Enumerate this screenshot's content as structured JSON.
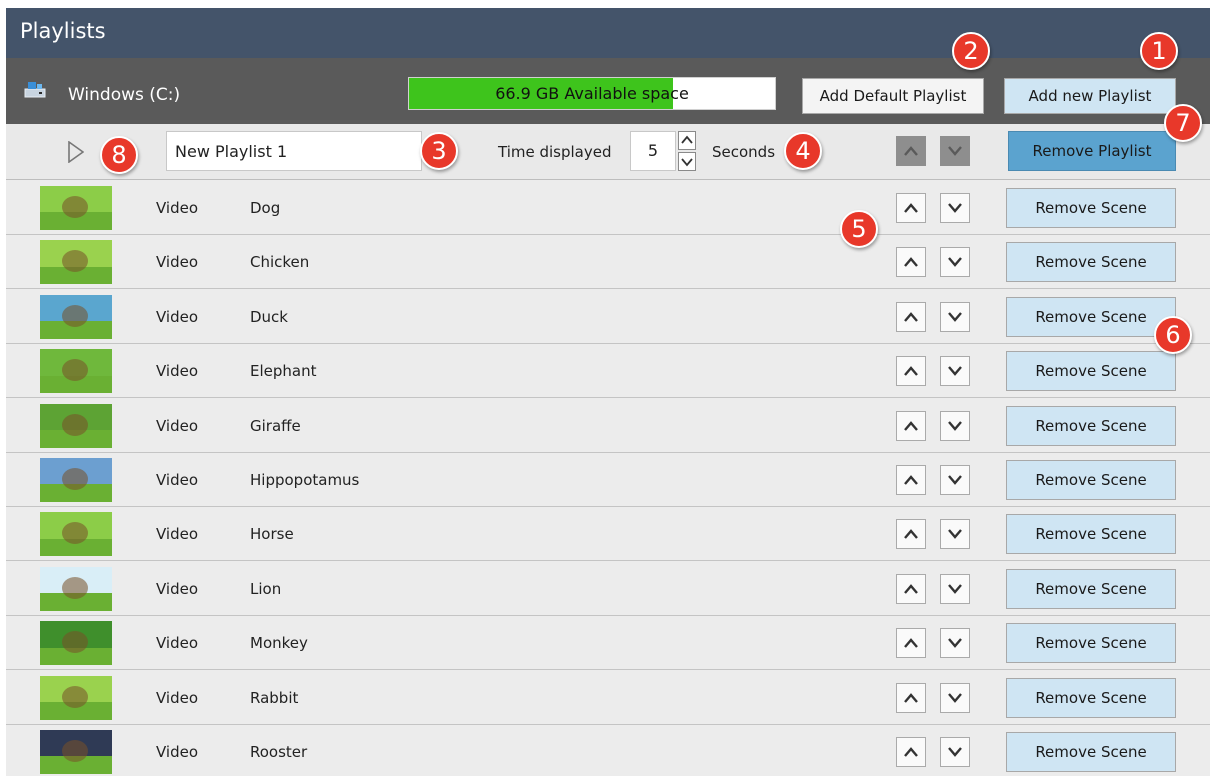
{
  "app": {
    "title": "Playlists"
  },
  "drive": {
    "label": "Windows (C:)",
    "storage_text": "66.9 GB Available space",
    "storage_fill_percent": 72,
    "icon": "drive-icon"
  },
  "buttons": {
    "add_default_playlist": "Add Default Playlist",
    "add_new_playlist": "Add new Playlist",
    "remove_playlist": "Remove Playlist"
  },
  "playlist": {
    "name": "New Playlist 1",
    "time_label": "Time displayed",
    "time_value": "5",
    "seconds_label": "Seconds"
  },
  "scenes": [
    {
      "type": "Video",
      "name": "Dog",
      "remove_label": "Remove Scene",
      "thumb_color": "#8ccd48"
    },
    {
      "type": "Video",
      "name": "Chicken",
      "remove_label": "Remove Scene",
      "thumb_color": "#9ad24e"
    },
    {
      "type": "Video",
      "name": "Duck",
      "remove_label": "Remove Scene",
      "thumb_color": "#5aa6cf"
    },
    {
      "type": "Video",
      "name": "Elephant",
      "remove_label": "Remove Scene",
      "thumb_color": "#6fb83c"
    },
    {
      "type": "Video",
      "name": "Giraffe",
      "remove_label": "Remove Scene",
      "thumb_color": "#5da334"
    },
    {
      "type": "Video",
      "name": "Hippopotamus",
      "remove_label": "Remove Scene",
      "thumb_color": "#6c9fd0"
    },
    {
      "type": "Video",
      "name": "Horse",
      "remove_label": "Remove Scene",
      "thumb_color": "#8ccd48"
    },
    {
      "type": "Video",
      "name": "Lion",
      "remove_label": "Remove Scene",
      "thumb_color": "#d9eef7"
    },
    {
      "type": "Video",
      "name": "Monkey",
      "remove_label": "Remove Scene",
      "thumb_color": "#3f8f2c"
    },
    {
      "type": "Video",
      "name": "Rabbit",
      "remove_label": "Remove Scene",
      "thumb_color": "#9ad24e"
    },
    {
      "type": "Video",
      "name": "Rooster",
      "remove_label": "Remove Scene",
      "thumb_color": "#2f3a55"
    }
  ],
  "callouts": [
    "1",
    "2",
    "3",
    "4",
    "5",
    "6",
    "7",
    "8"
  ],
  "colors": {
    "title_bar": "#44546a",
    "drive_bar": "#5a5a5a",
    "storage_fill": "#3ec41c",
    "primary_button": "#5ba3cf",
    "secondary_button": "#cfe5f3",
    "callout": "#e8382a"
  }
}
